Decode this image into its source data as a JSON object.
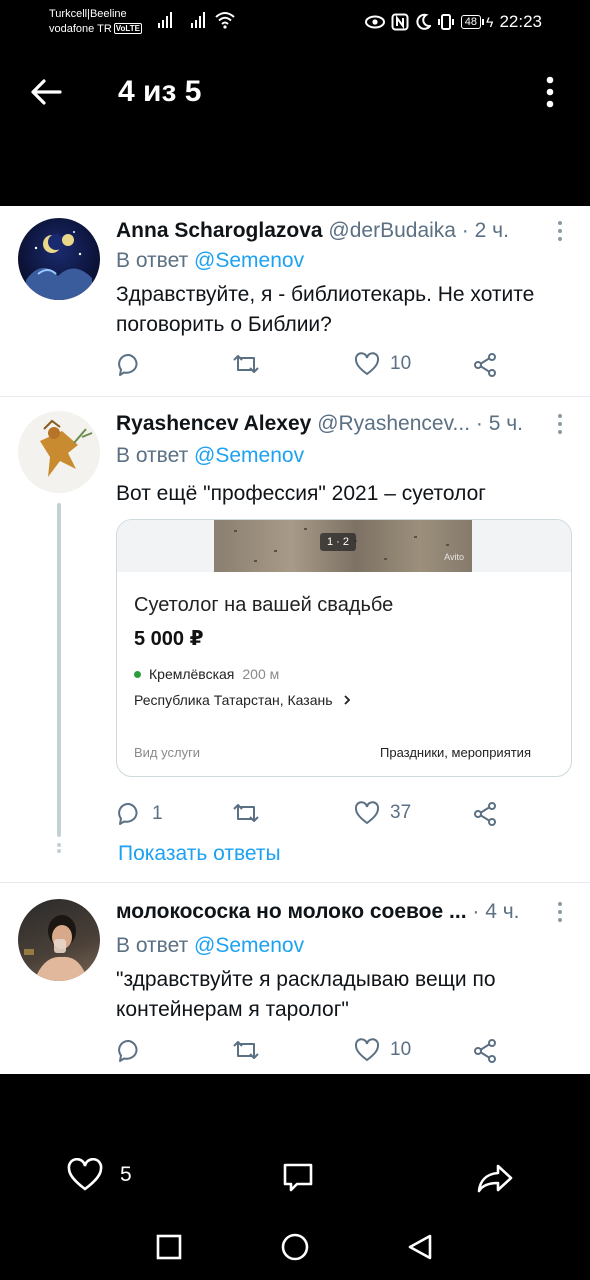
{
  "status_bar": {
    "carrier1": "Turkcell|Beeline",
    "carrier2": "vodafone TR",
    "volte": "VoLTE",
    "battery": "48",
    "time": "22:23"
  },
  "top_bar": {
    "page_counter": "4 из 5"
  },
  "tweets": [
    {
      "name": "Anna Scharoglazova",
      "meta": "@derBudaika · 2 ч.",
      "reply_prefix": "В ответ",
      "reply_to": "@Semenov",
      "text": "Здравствуйте, я - библиотекарь. Не хотите поговорить о Библии?",
      "likes": "10"
    },
    {
      "name": "Ryashencev Alexey",
      "meta": "@Ryashencev...  · 5 ч.",
      "reply_prefix": "В ответ",
      "reply_to": "@Semenov",
      "text": "Вот ещё \"профессия\" 2021 – суетолог",
      "replies": "1",
      "likes": "37",
      "show_replies": "Показать ответы",
      "embed": {
        "pager": "1 · 2",
        "watermark": "Avito",
        "title": "Суетолог на вашей свадьбе",
        "price": "5 000 ₽",
        "metro": "Кремлёвская",
        "distance": "200 м",
        "city": "Республика Татарстан, Казань",
        "service_label": "Вид услуги",
        "service_value": "Праздники, мероприятия"
      }
    },
    {
      "name": "молокососка но молоко соевое ...",
      "meta": " · 4 ч.",
      "reply_prefix": "В ответ",
      "reply_to": "@Semenov",
      "text": "\"здравствуйте я раскладываю вещи по контейнерам я таролог\"",
      "likes": "10"
    }
  ],
  "bottom": {
    "like_count": "5"
  },
  "colors": {
    "accent": "#1da1f2",
    "muted": "#5b7083"
  }
}
